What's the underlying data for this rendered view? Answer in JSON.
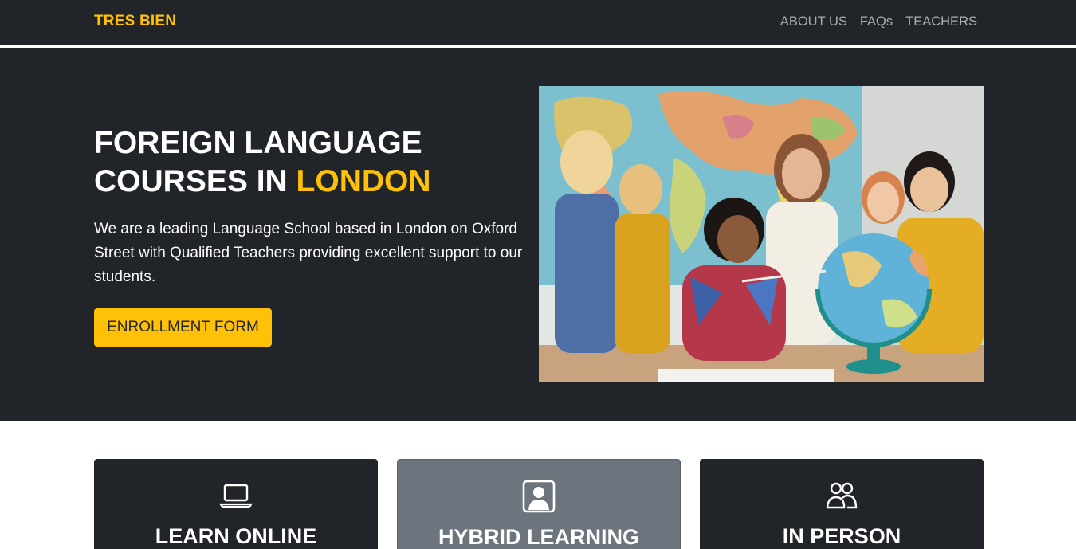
{
  "navbar": {
    "brand": "TRES BIEN",
    "links": [
      {
        "label": "ABOUT US"
      },
      {
        "label": "FAQs"
      },
      {
        "label": "TEACHERS"
      }
    ]
  },
  "hero": {
    "title_line1": "FOREIGN LANGUAGE",
    "title_line2_prefix": "COURSES IN ",
    "title_accent": "LONDON",
    "description": "We are a leading Language School based in London on Oxford Street with Qualified Teachers providing excellent support to our students.",
    "cta_label": "ENROLLMENT FORM",
    "image_alt": "Teacher and children looking at a globe in front of a world map"
  },
  "cards": [
    {
      "title": "LEARN ONLINE",
      "icon": "laptop-icon"
    },
    {
      "title": "HYBRID LEARNING",
      "icon": "person-badge-icon"
    },
    {
      "title": "IN PERSON",
      "icon": "people-icon"
    }
  ],
  "colors": {
    "dark": "#212529",
    "accent": "#ffc107",
    "secondary": "#6c757d"
  }
}
